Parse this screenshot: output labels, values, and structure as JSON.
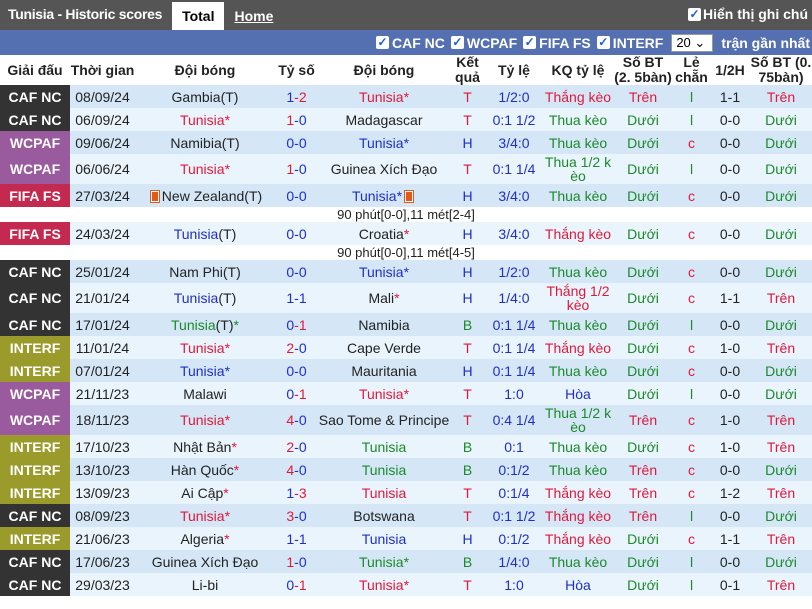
{
  "header": {
    "title": "Tunisia - Historic scores",
    "tabs": [
      "Total",
      "Home"
    ],
    "show_notes": "Hiển thị ghi chú"
  },
  "filters": {
    "competitions": [
      "CAF NC",
      "WCPAF",
      "FIFA FS",
      "INTERF"
    ],
    "count": "20",
    "count_suffix": "trận gần nhất"
  },
  "columns": [
    "Giải đấu",
    "Thời gian",
    "Đội bóng",
    "Tỷ số",
    "Đội bóng",
    "Kết quả",
    "Tỷ lệ",
    "KQ tỷ lệ",
    "Số BT (2. 5bàn)",
    "Lẻ chẵn",
    "1/2H",
    "Số BT (0. 75bàn)"
  ],
  "comp_colors": {
    "CAF NC": "#333333",
    "WCPAF": "#9a5a9e",
    "FIFA FS": "#c4294f",
    "INTERF": "#9b9b2b"
  },
  "rows": [
    {
      "comp": "CAF NC",
      "date": "08/09/24",
      "home": {
        "name": "Gambia",
        "t": "(T)",
        "star": ""
      },
      "score": "1-2",
      "away": {
        "name": "Tunisia",
        "t": "",
        "star": "*"
      },
      "res": "T",
      "odds": "1/2:0",
      "odds_res": "Thắng kèo",
      "bt": "Trên",
      "lc": "l",
      "ht": "1-1",
      "bt2": "Trên"
    },
    {
      "comp": "CAF NC",
      "date": "06/09/24",
      "home": {
        "name": "Tunisia",
        "t": "",
        "star": "*"
      },
      "score": "1-0",
      "away": {
        "name": "Madagascar",
        "t": "",
        "star": ""
      },
      "res": "T",
      "odds": "0:1 1/2",
      "odds_res": "Thua kèo",
      "bt": "Dưới",
      "lc": "l",
      "ht": "0-0",
      "bt2": "Dưới"
    },
    {
      "comp": "WCPAF",
      "date": "09/06/24",
      "home": {
        "name": "Namibia",
        "t": "(T)",
        "star": ""
      },
      "score": "0-0",
      "away": {
        "name": "Tunisia",
        "t": "",
        "star": "*"
      },
      "res": "H",
      "odds": "3/4:0",
      "odds_res": "Thua kèo",
      "bt": "Dưới",
      "lc": "c",
      "ht": "0-0",
      "bt2": "Dưới"
    },
    {
      "comp": "WCPAF",
      "date": "06/06/24",
      "home": {
        "name": "Tunisia",
        "t": "",
        "star": "*"
      },
      "score": "1-0",
      "away": {
        "name": "Guinea Xích Đạo",
        "t": "",
        "star": ""
      },
      "res": "T",
      "odds": "0:1 1/4",
      "odds_res": "Thua 1/2 k èo",
      "bt": "Dưới",
      "lc": "l",
      "ht": "0-0",
      "bt2": "Dưới",
      "tall": true
    },
    {
      "comp": "FIFA FS",
      "date": "27/03/24",
      "home": {
        "name": "New Zealand",
        "t": "(T)",
        "star": "",
        "card_before": true
      },
      "score": "0-0",
      "away": {
        "name": "Tunisia",
        "t": "",
        "star": "*",
        "card_after": true
      },
      "res": "H",
      "odds": "3/4:0",
      "odds_res": "Thua kèo",
      "bt": "Dưới",
      "lc": "c",
      "ht": "0-0",
      "bt2": "Dưới",
      "note": "90 phút[0-0],11 mét[2-4]"
    },
    {
      "comp": "FIFA FS",
      "date": "24/03/24",
      "home": {
        "name": "Tunisia",
        "t": "(T)",
        "star": ""
      },
      "score": "0-0",
      "away": {
        "name": "Croatia",
        "t": "",
        "star": "*"
      },
      "res": "H",
      "odds": "3/4:0",
      "odds_res": "Thắng kèo",
      "bt": "Dưới",
      "lc": "c",
      "ht": "0-0",
      "bt2": "Dưới",
      "note": "90 phút[0-0],11 mét[4-5]"
    },
    {
      "comp": "CAF NC",
      "date": "25/01/24",
      "home": {
        "name": "Nam Phi",
        "t": "(T)",
        "star": ""
      },
      "score": "0-0",
      "away": {
        "name": "Tunisia",
        "t": "",
        "star": "*"
      },
      "res": "H",
      "odds": "1/2:0",
      "odds_res": "Thua kèo",
      "bt": "Dưới",
      "lc": "c",
      "ht": "0-0",
      "bt2": "Dưới"
    },
    {
      "comp": "CAF NC",
      "date": "21/01/24",
      "home": {
        "name": "Tunisia",
        "t": "(T)",
        "star": ""
      },
      "score": "1-1",
      "away": {
        "name": "Mali",
        "t": "",
        "star": "*"
      },
      "res": "H",
      "odds": "1/4:0",
      "odds_res": "Thắng 1/2 kèo",
      "bt": "Dưới",
      "lc": "c",
      "ht": "1-1",
      "bt2": "Trên",
      "tall": true
    },
    {
      "comp": "CAF NC",
      "date": "17/01/24",
      "home": {
        "name": "Tunisia",
        "t": "(T)",
        "star": "*"
      },
      "score": "0-1",
      "away": {
        "name": "Namibia",
        "t": "",
        "star": ""
      },
      "res": "B",
      "odds": "0:1 1/4",
      "odds_res": "Thua kèo",
      "bt": "Dưới",
      "lc": "l",
      "ht": "0-0",
      "bt2": "Dưới"
    },
    {
      "comp": "INTERF",
      "date": "11/01/24",
      "home": {
        "name": "Tunisia",
        "t": "",
        "star": "*"
      },
      "score": "2-0",
      "away": {
        "name": "Cape Verde",
        "t": "",
        "star": ""
      },
      "res": "T",
      "odds": "0:1 1/4",
      "odds_res": "Thắng kèo",
      "bt": "Dưới",
      "lc": "c",
      "ht": "1-0",
      "bt2": "Trên"
    },
    {
      "comp": "INTERF",
      "date": "07/01/24",
      "home": {
        "name": "Tunisia",
        "t": "",
        "star": "*"
      },
      "score": "0-0",
      "away": {
        "name": "Mauritania",
        "t": "",
        "star": ""
      },
      "res": "H",
      "odds": "0:1 1/4",
      "odds_res": "Thua kèo",
      "bt": "Dưới",
      "lc": "c",
      "ht": "0-0",
      "bt2": "Dưới"
    },
    {
      "comp": "WCPAF",
      "date": "21/11/23",
      "home": {
        "name": "Malawi",
        "t": "",
        "star": ""
      },
      "score": "0-1",
      "away": {
        "name": "Tunisia",
        "t": "",
        "star": "*"
      },
      "res": "T",
      "odds": "1:0",
      "odds_res": "Hòa",
      "bt": "Dưới",
      "lc": "l",
      "ht": "0-0",
      "bt2": "Dưới"
    },
    {
      "comp": "WCPAF",
      "date": "18/11/23",
      "home": {
        "name": "Tunisia",
        "t": "",
        "star": "*"
      },
      "score": "4-0",
      "away": {
        "name": "Sao Tome & Principe",
        "t": "",
        "star": ""
      },
      "res": "T",
      "odds": "0:4 1/4",
      "odds_res": "Thua 1/2 k èo",
      "bt": "Trên",
      "lc": "c",
      "ht": "1-0",
      "bt2": "Trên",
      "tall": true
    },
    {
      "comp": "INTERF",
      "date": "17/10/23",
      "home": {
        "name": "Nhật Bản",
        "t": "",
        "star": "*"
      },
      "score": "2-0",
      "away": {
        "name": "Tunisia",
        "t": "",
        "star": ""
      },
      "res": "B",
      "odds": "0:1",
      "odds_res": "Thua kèo",
      "bt": "Dưới",
      "lc": "c",
      "ht": "1-0",
      "bt2": "Trên"
    },
    {
      "comp": "INTERF",
      "date": "13/10/23",
      "home": {
        "name": "Hàn Quốc",
        "t": "",
        "star": "*"
      },
      "score": "4-0",
      "away": {
        "name": "Tunisia",
        "t": "",
        "star": ""
      },
      "res": "B",
      "odds": "0:1/2",
      "odds_res": "Thua kèo",
      "bt": "Trên",
      "lc": "c",
      "ht": "0-0",
      "bt2": "Dưới"
    },
    {
      "comp": "INTERF",
      "date": "13/09/23",
      "home": {
        "name": "Ai Cập",
        "t": "",
        "star": "*"
      },
      "score": "1-3",
      "away": {
        "name": "Tunisia",
        "t": "",
        "star": ""
      },
      "res": "T",
      "odds": "0:1/4",
      "odds_res": "Thắng kèo",
      "bt": "Trên",
      "lc": "c",
      "ht": "1-2",
      "bt2": "Trên"
    },
    {
      "comp": "CAF NC",
      "date": "08/09/23",
      "home": {
        "name": "Tunisia",
        "t": "",
        "star": "*"
      },
      "score": "3-0",
      "away": {
        "name": "Botswana",
        "t": "",
        "star": ""
      },
      "res": "T",
      "odds": "0:1 1/2",
      "odds_res": "Thắng kèo",
      "bt": "Trên",
      "lc": "l",
      "ht": "0-0",
      "bt2": "Dưới"
    },
    {
      "comp": "INTERF",
      "date": "21/06/23",
      "home": {
        "name": "Algeria",
        "t": "",
        "star": "*"
      },
      "score": "1-1",
      "away": {
        "name": "Tunisia",
        "t": "",
        "star": ""
      },
      "res": "H",
      "odds": "0:1/2",
      "odds_res": "Thắng kèo",
      "bt": "Dưới",
      "lc": "c",
      "ht": "1-1",
      "bt2": "Trên"
    },
    {
      "comp": "CAF NC",
      "date": "17/06/23",
      "home": {
        "name": "Guinea Xích Đạo",
        "t": "",
        "star": ""
      },
      "score": "1-0",
      "away": {
        "name": "Tunisia",
        "t": "",
        "star": "*"
      },
      "res": "B",
      "odds": "1/4:0",
      "odds_res": "Thua kèo",
      "bt": "Dưới",
      "lc": "l",
      "ht": "0-0",
      "bt2": "Dưới"
    },
    {
      "comp": "CAF NC",
      "date": "29/03/23",
      "home": {
        "name": "Li-bi",
        "t": "",
        "star": ""
      },
      "score": "0-1",
      "away": {
        "name": "Tunisia",
        "t": "",
        "star": "*"
      },
      "res": "T",
      "odds": "1:0",
      "odds_res": "Hòa",
      "bt": "Dưới",
      "lc": "l",
      "ht": "0-1",
      "bt2": "Trên"
    }
  ]
}
